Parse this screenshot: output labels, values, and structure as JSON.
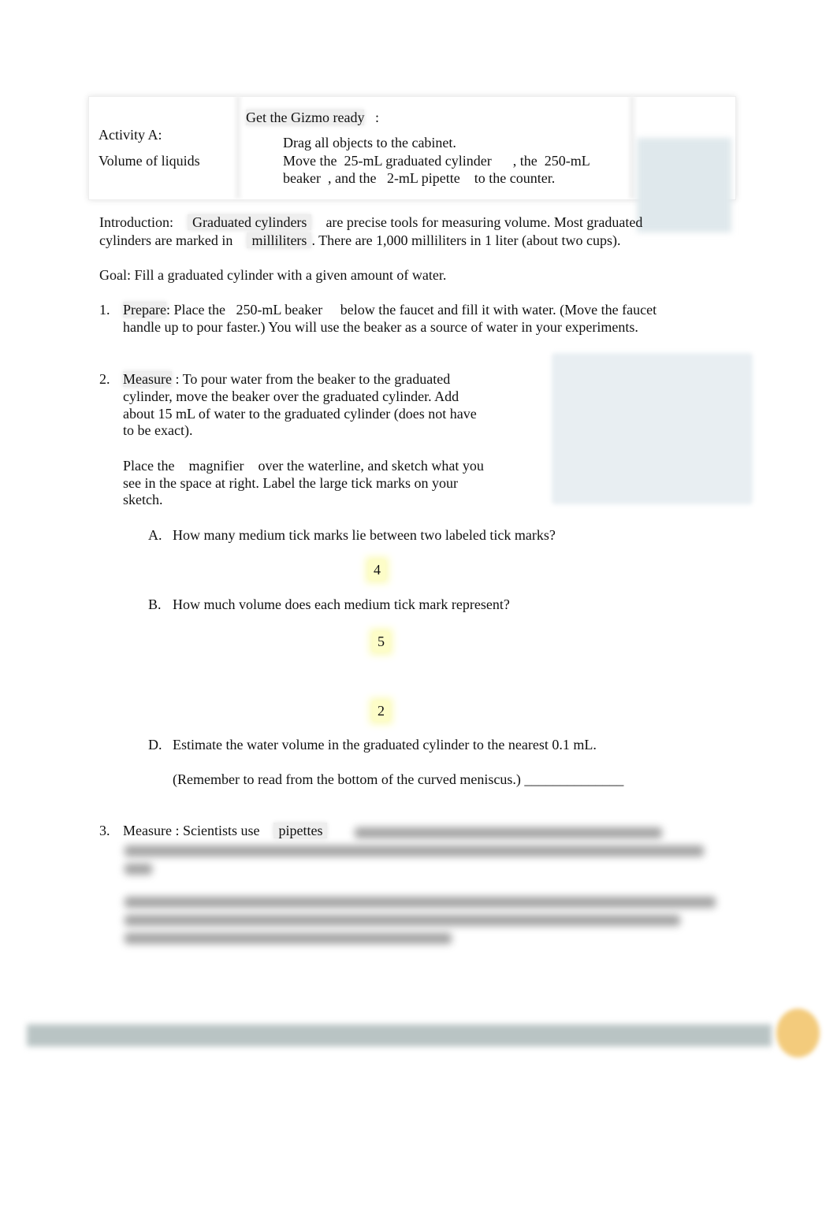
{
  "header": {
    "activity": "Activity A:",
    "activity_title": "Volume of liquids",
    "ready_label": "Get the Gizmo ready",
    "ready_colon": ":",
    "bullet_glyph": "",
    "steps": [
      "Drag all objects to the cabinet.",
      "Move the  25-mL graduated cylinder      , the  250-mL",
      "beaker  , and the   2-mL pipette    to the counter."
    ]
  },
  "intro": {
    "label": "Introduction:",
    "term1": "Graduated cylinders",
    "text1": "are precise tools for measuring volume. Most graduated",
    "text2": "cylinders are marked in",
    "term2": "milliliters",
    "text3": ". There are 1,000 milliliters in 1 liter (about two cups)."
  },
  "goal": "Goal: Fill a graduated cylinder with a given amount of water.",
  "q1": {
    "num": "1.",
    "term": "Prepare",
    "line1": ": Place the   250-mL beaker     below the faucet and fill it with water. (Move the faucet",
    "line2": "handle up to pour faster.) You will use the beaker as a source of water in your experiments."
  },
  "q2": {
    "num": "2.",
    "term": "Measure",
    "lines": [
      ": To pour water from the beaker to the graduated",
      "cylinder, move the beaker over the graduated cylinder. Add",
      "about 15 mL of water to the graduated cylinder (does not have",
      "to be exact)."
    ],
    "lines2": [
      "Place the    magnifier    over the waterline, and sketch what you",
      "see in the space at right. Label the large tick marks on your",
      "sketch."
    ],
    "A": {
      "label": "A.",
      "text": "How many medium tick marks lie between two labeled tick marks?",
      "answer": "4"
    },
    "B": {
      "label": "B.",
      "text": "How much volume does each medium tick mark represent?",
      "answer": "5"
    },
    "C": {
      "answer": "2"
    },
    "D": {
      "label": "D.",
      "text": "Estimate the water volume in the graduated cylinder to the nearest 0.1 mL.",
      "text2": "(Remember to read from the bottom of the curved meniscus.) ______________"
    }
  },
  "q3": {
    "num": "3.",
    "term": "Measure",
    "text": ": Scientists use",
    "term2": "pipettes"
  }
}
